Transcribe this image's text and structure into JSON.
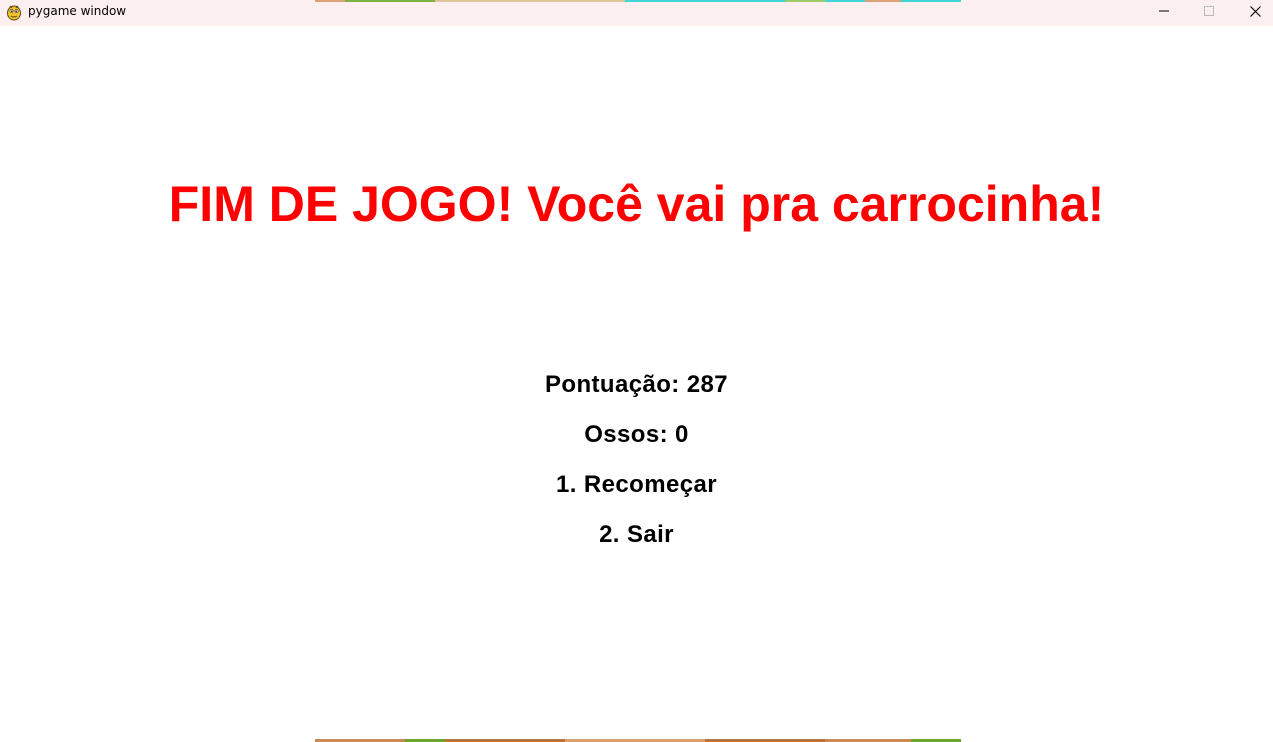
{
  "window": {
    "title": "pygame window",
    "controls": {
      "minimize_icon": "minimize-icon",
      "maximize_icon": "maximize-icon",
      "close_icon": "close-icon"
    },
    "app_icon": "pygame-snake-icon"
  },
  "game_over": {
    "headline": "FIM DE JOGO! Você vai pra carrocinha!",
    "score_text": "Pontuação: 287",
    "bones_text": "Ossos: 0",
    "restart_option": "1. Recomeçar",
    "exit_option": "2. Sair"
  },
  "colors": {
    "headline": "#ff0000",
    "text": "#000000",
    "background": "#ffffff",
    "titlebar": "#fbefef"
  }
}
